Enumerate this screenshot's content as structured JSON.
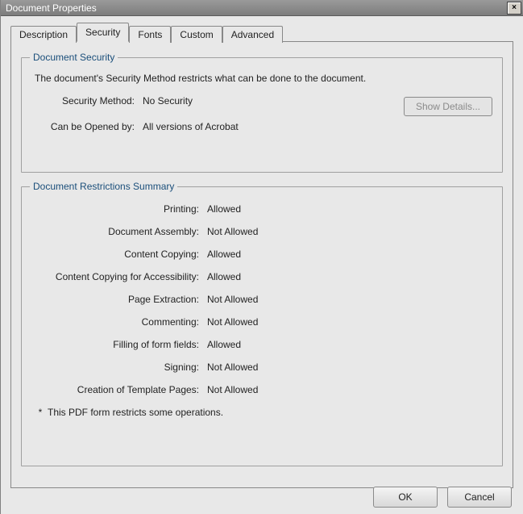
{
  "window": {
    "title": "Document Properties",
    "close_label": "✕"
  },
  "tabs": {
    "description": "Description",
    "security": "Security",
    "fonts": "Fonts",
    "custom": "Custom",
    "advanced": "Advanced"
  },
  "security_group": {
    "legend": "Document Security",
    "description": "The document's Security Method restricts what can be done to the document.",
    "method_label": "Security Method:",
    "method_value": "No Security",
    "opened_by_label": "Can be Opened by:",
    "opened_by_value": "All versions of Acrobat",
    "show_details": "Show Details..."
  },
  "restrictions_group": {
    "legend": "Document Restrictions Summary",
    "rows": [
      {
        "label": "Printing:",
        "value": "Allowed"
      },
      {
        "label": "Document Assembly:",
        "value": "Not Allowed"
      },
      {
        "label": "Content Copying:",
        "value": "Allowed"
      },
      {
        "label": "Content Copying for Accessibility:",
        "value": "Allowed"
      },
      {
        "label": "Page Extraction:",
        "value": "Not Allowed"
      },
      {
        "label": "Commenting:",
        "value": "Not Allowed"
      },
      {
        "label": "Filling of form fields:",
        "value": "Allowed"
      },
      {
        "label": "Signing:",
        "value": "Not Allowed"
      },
      {
        "label": "Creation of Template Pages:",
        "value": "Not Allowed"
      }
    ],
    "note_star": "*",
    "note": "This PDF form restricts some operations."
  },
  "buttons": {
    "ok": "OK",
    "cancel": "Cancel"
  }
}
